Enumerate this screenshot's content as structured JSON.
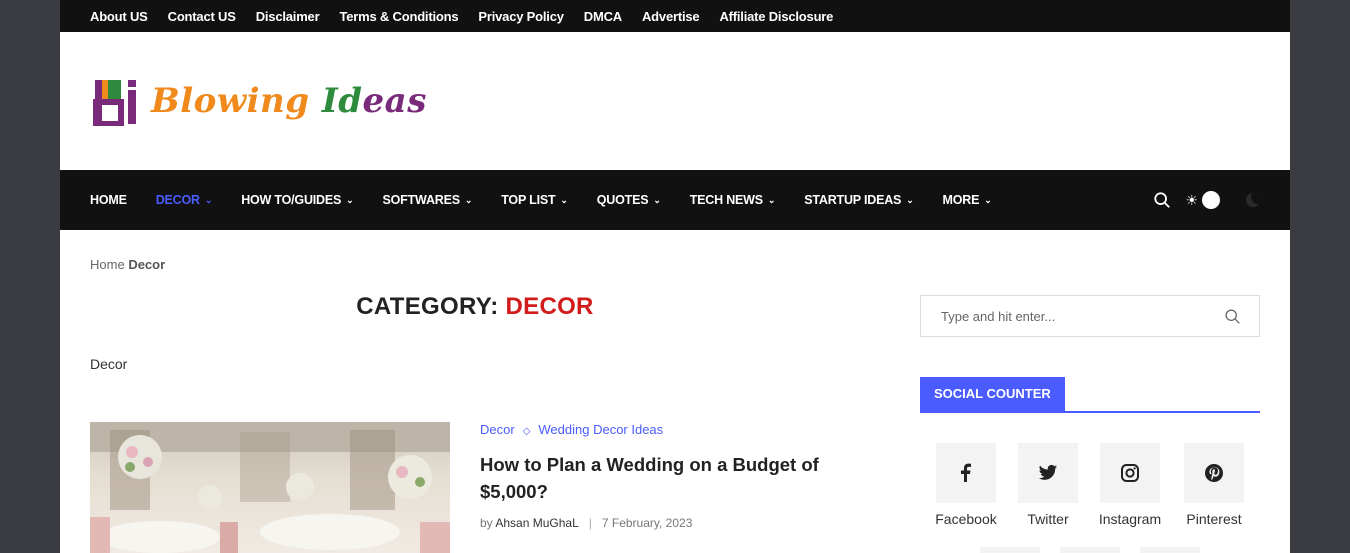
{
  "topbar": {
    "links": [
      "About US",
      "Contact US",
      "Disclaimer",
      "Terms & Conditions",
      "Privacy Policy",
      "DMCA",
      "Advertise",
      "Affiliate Disclosure"
    ]
  },
  "logo": {
    "part1": "Blowing ",
    "part2": "Id",
    "part3": "eas"
  },
  "nav": {
    "items": [
      {
        "label": "HOME",
        "dropdown": false,
        "active": false
      },
      {
        "label": "DECOR",
        "dropdown": true,
        "active": true
      },
      {
        "label": "HOW TO/GUIDES",
        "dropdown": true,
        "active": false
      },
      {
        "label": "SOFTWARES",
        "dropdown": true,
        "active": false
      },
      {
        "label": "TOP LIST",
        "dropdown": true,
        "active": false
      },
      {
        "label": "QUOTES",
        "dropdown": true,
        "active": false
      },
      {
        "label": "TECH NEWS",
        "dropdown": true,
        "active": false
      },
      {
        "label": "STARTUP IDEAS",
        "dropdown": true,
        "active": false
      },
      {
        "label": "MORE",
        "dropdown": true,
        "active": false
      }
    ]
  },
  "breadcrumb": {
    "home": "Home",
    "current": "Decor"
  },
  "category": {
    "prefix": "CATEGORY:",
    "name": "DECOR",
    "description": "Decor"
  },
  "post": {
    "category1": "Decor",
    "category2": "Wedding Decor Ideas",
    "title": "How to Plan a Wedding on a Budget of $5,000?",
    "by": "by",
    "author": "Ahsan MuGhaL",
    "date": "7 February, 2023"
  },
  "sidebar": {
    "search_placeholder": "Type and hit enter...",
    "social_title": "SOCIAL COUNTER",
    "social": [
      {
        "label": "Facebook",
        "icon": "facebook-icon"
      },
      {
        "label": "Twitter",
        "icon": "twitter-icon"
      },
      {
        "label": "Instagram",
        "icon": "instagram-icon"
      },
      {
        "label": "Pinterest",
        "icon": "pinterest-icon"
      }
    ]
  },
  "colors": {
    "accent": "#4a5cff",
    "category_red": "#d21b1b",
    "bar": "#111111"
  }
}
